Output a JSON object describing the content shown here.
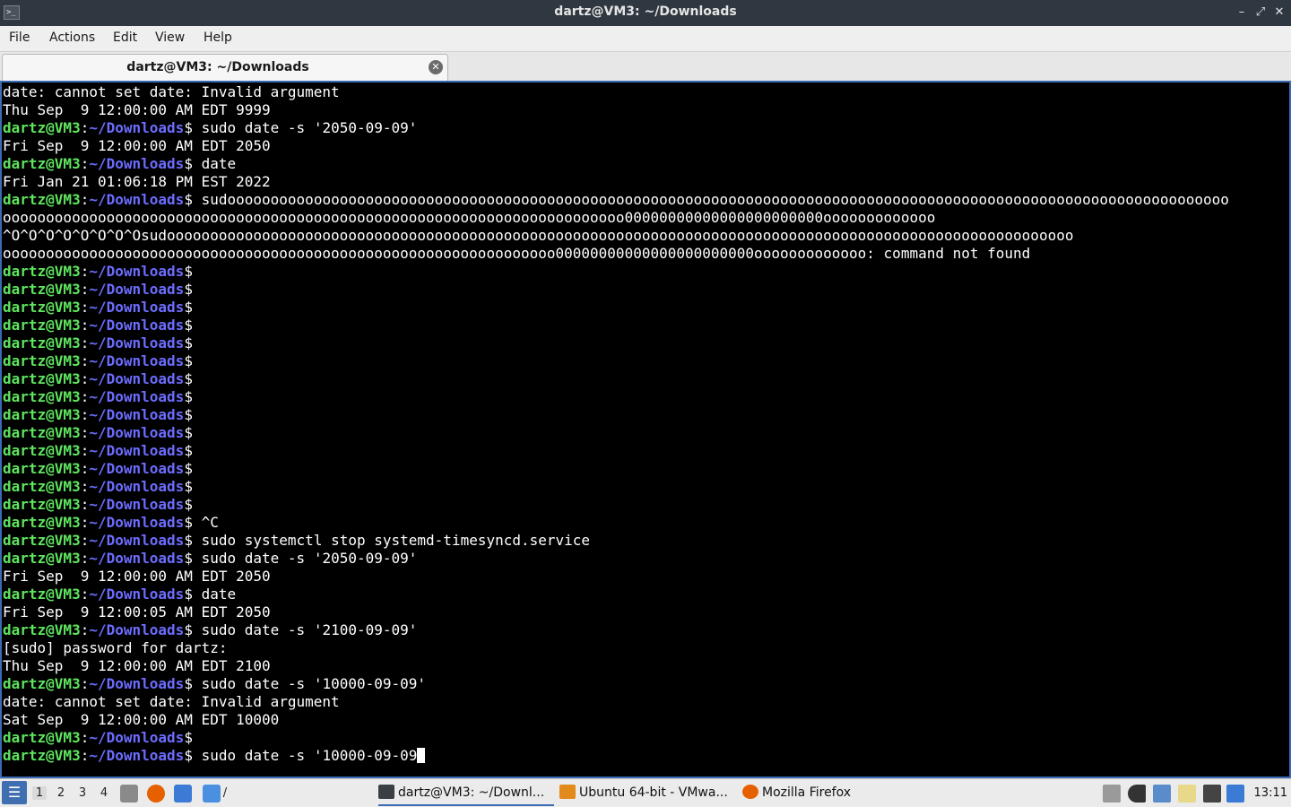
{
  "window": {
    "title": "dartz@VM3: ~/Downloads",
    "buttons": {
      "minimize": "–",
      "restore": "⤢",
      "close": "✕"
    }
  },
  "menu": {
    "items": [
      "File",
      "Actions",
      "Edit",
      "View",
      "Help"
    ]
  },
  "tab": {
    "label": "dartz@VM3: ~/Downloads",
    "close_glyph": "✕"
  },
  "prompt": {
    "user": "dartz@VM3",
    "sep": ":",
    "path": "~/Downloads",
    "dollar": "$"
  },
  "terminal": {
    "colors": {
      "background": "#000000",
      "user": "#5ee45e",
      "path": "#6c6cff",
      "text": "#ffffff",
      "border": "#3b6bb5"
    },
    "lines": [
      {
        "prompt": false,
        "text": "date: cannot set date: Invalid argument"
      },
      {
        "prompt": false,
        "text": "Thu Sep  9 12:00:00 AM EDT 9999"
      },
      {
        "prompt": true,
        "text": " sudo date -s '2050-09-09'"
      },
      {
        "prompt": false,
        "text": "Fri Sep  9 12:00:00 AM EDT 2050"
      },
      {
        "prompt": true,
        "text": " date"
      },
      {
        "prompt": false,
        "text": "Fri Jan 21 01:06:18 PM EST 2022"
      },
      {
        "prompt": true,
        "text": " sudoooooooooooooooooooooooooooooooooooooooooooooooooooooooooooooooooooooooooooooooooooooooooooooooooooooooooooooooooooo"
      },
      {
        "prompt": false,
        "text": "oooooooooooooooooooooooooooooooooooooooooooooooooooooooooooooooooooooooo00000000000000000000000ooooooooooooo"
      },
      {
        "prompt": false,
        "text": "^O^O^O^O^O^O^O^Osudooooooooooooooooooooooooooooooooooooooooooooooooooooooooooooooooooooooooooooooooooooooooooooooooooooooooo"
      },
      {
        "prompt": false,
        "text": "oooooooooooooooooooooooooooooooooooooooooooooooooooooooooooooooo00000000000000000000000ooooooooooooo: command not found"
      },
      {
        "prompt": true,
        "text": ""
      },
      {
        "prompt": true,
        "text": ""
      },
      {
        "prompt": true,
        "text": ""
      },
      {
        "prompt": true,
        "text": ""
      },
      {
        "prompt": true,
        "text": ""
      },
      {
        "prompt": true,
        "text": ""
      },
      {
        "prompt": true,
        "text": ""
      },
      {
        "prompt": true,
        "text": ""
      },
      {
        "prompt": true,
        "text": ""
      },
      {
        "prompt": true,
        "text": ""
      },
      {
        "prompt": true,
        "text": ""
      },
      {
        "prompt": true,
        "text": ""
      },
      {
        "prompt": true,
        "text": ""
      },
      {
        "prompt": true,
        "text": ""
      },
      {
        "prompt": true,
        "text": " ^C"
      },
      {
        "prompt": true,
        "text": " sudo systemctl stop systemd-timesyncd.service"
      },
      {
        "prompt": true,
        "text": " sudo date -s '2050-09-09'"
      },
      {
        "prompt": false,
        "text": "Fri Sep  9 12:00:00 AM EDT 2050"
      },
      {
        "prompt": true,
        "text": " date"
      },
      {
        "prompt": false,
        "text": "Fri Sep  9 12:00:05 AM EDT 2050"
      },
      {
        "prompt": true,
        "text": " sudo date -s '2100-09-09'"
      },
      {
        "prompt": false,
        "text": "[sudo] password for dartz:"
      },
      {
        "prompt": false,
        "text": "Thu Sep  9 12:00:00 AM EDT 2100"
      },
      {
        "prompt": true,
        "text": " sudo date -s '10000-09-09'"
      },
      {
        "prompt": false,
        "text": "date: cannot set date: Invalid argument"
      },
      {
        "prompt": false,
        "text": "Sat Sep  9 12:00:00 AM EDT 10000"
      },
      {
        "prompt": true,
        "text": ""
      },
      {
        "prompt": true,
        "text": " sudo date -s '10000-09-09",
        "cursor": true
      }
    ]
  },
  "taskbar": {
    "start_icon": "start-menu-icon",
    "workspaces": [
      "1",
      "2",
      "3",
      "4"
    ],
    "active_workspace": "1",
    "quicklaunch": [
      {
        "name": "file-manager-icon",
        "color": "#8a8a8a"
      },
      {
        "name": "firefox-icon",
        "color": "#e66000"
      },
      {
        "name": "desktop-icon",
        "color": "#3b7bd6"
      },
      {
        "name": "folder-icon",
        "color": "#4a8fe0"
      }
    ],
    "folder_path": "/",
    "tasks": [
      {
        "label": "dartz@VM3: ~/Downl...",
        "icon": "terminal-icon",
        "color": "#3a3f45",
        "active": true
      },
      {
        "label": "Ubuntu 64-bit - VMwa...",
        "icon": "vmware-icon",
        "color": "#e28a1c",
        "active": false
      },
      {
        "label": "Mozilla Firefox",
        "icon": "firefox-icon",
        "color": "#e66000",
        "active": false
      }
    ],
    "tray": [
      {
        "name": "keyboard-layout-icon",
        "color": "#9a9a9a"
      },
      {
        "name": "volume-icon",
        "color": "#333333"
      },
      {
        "name": "network-icon",
        "color": "#5a8ccc"
      },
      {
        "name": "clipboard-icon",
        "color": "#e8d98a"
      },
      {
        "name": "display-icon",
        "color": "#444444"
      },
      {
        "name": "update-icon",
        "color": "#3b7bd6"
      }
    ],
    "clock": "13:11"
  }
}
